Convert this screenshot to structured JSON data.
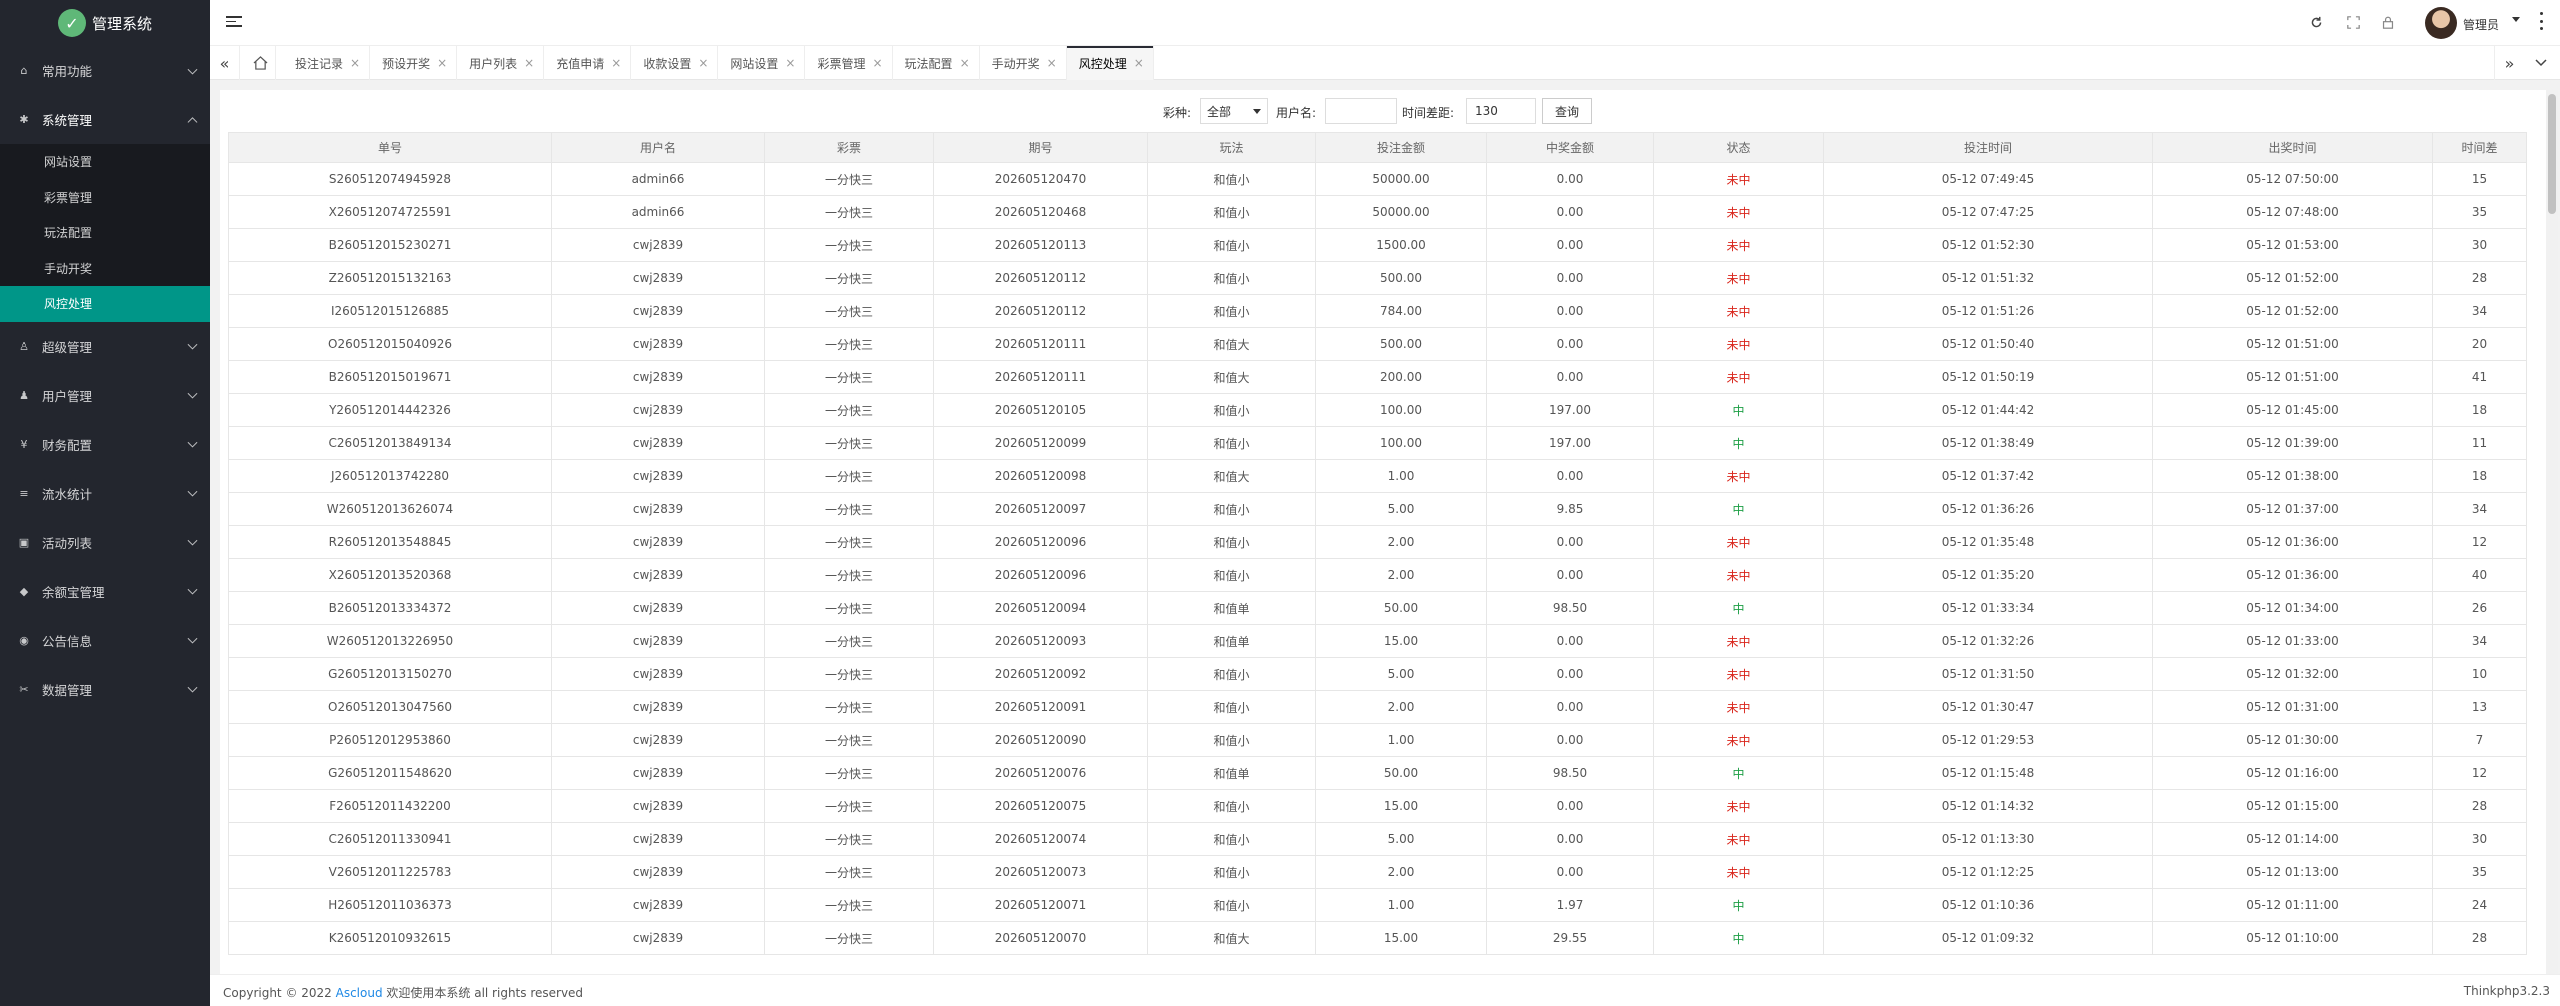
{
  "app": {
    "title": "管理系统",
    "logo_icon": "leaf-logo-icon"
  },
  "header": {
    "user": "管理员",
    "icons": [
      "refresh-icon",
      "fullscreen-icon",
      "lock-icon"
    ]
  },
  "sidebar": {
    "items": [
      {
        "label": "常用功能",
        "icon": "home-icon",
        "open": false
      },
      {
        "label": "系统管理",
        "icon": "gear-icon",
        "open": true,
        "children": [
          {
            "label": "网站设置",
            "active": false
          },
          {
            "label": "彩票管理",
            "active": false
          },
          {
            "label": "玩法配置",
            "active": false
          },
          {
            "label": "手动开奖",
            "active": false
          },
          {
            "label": "风控处理",
            "active": true
          }
        ]
      },
      {
        "label": "超级管理",
        "icon": "user-icon",
        "open": false
      },
      {
        "label": "用户管理",
        "icon": "users-icon",
        "open": false
      },
      {
        "label": "财务配置",
        "icon": "money-icon",
        "open": false
      },
      {
        "label": "流水统计",
        "icon": "list-icon",
        "open": false
      },
      {
        "label": "活动列表",
        "icon": "gift-icon",
        "open": false
      },
      {
        "label": "余额宝管理",
        "icon": "diamond-icon",
        "open": false
      },
      {
        "label": "公告信息",
        "icon": "bell-icon",
        "open": false
      },
      {
        "label": "数据管理",
        "icon": "database-icon",
        "open": false
      }
    ]
  },
  "tabs": [
    {
      "label": "投注记录",
      "active": false
    },
    {
      "label": "预设开奖",
      "active": false
    },
    {
      "label": "用户列表",
      "active": false
    },
    {
      "label": "充值申请",
      "active": false
    },
    {
      "label": "收款设置",
      "active": false
    },
    {
      "label": "网站设置",
      "active": false
    },
    {
      "label": "彩票管理",
      "active": false
    },
    {
      "label": "玩法配置",
      "active": false
    },
    {
      "label": "手动开奖",
      "active": false
    },
    {
      "label": "风控处理",
      "active": true
    }
  ],
  "filter": {
    "lottery_label": "彩种:",
    "lottery_value": "全部",
    "username_label": "用户名:",
    "username_value": "",
    "timediff_label": "时间差距:",
    "timediff_value": "130",
    "query_label": "查询"
  },
  "table": {
    "columns": [
      "单号",
      "用户名",
      "彩票",
      "期号",
      "玩法",
      "投注金额",
      "中奖金额",
      "状态",
      "投注时间",
      "出奖时间",
      "时间差"
    ],
    "rows": [
      [
        "S260512074945928",
        "admin66",
        "一分快三",
        "202605120470",
        "和值小",
        "50000.00",
        "0.00",
        "未中",
        "05-12 07:49:45",
        "05-12 07:50:00",
        "15"
      ],
      [
        "X260512074725591",
        "admin66",
        "一分快三",
        "202605120468",
        "和值小",
        "50000.00",
        "0.00",
        "未中",
        "05-12 07:47:25",
        "05-12 07:48:00",
        "35"
      ],
      [
        "B260512015230271",
        "cwj2839",
        "一分快三",
        "202605120113",
        "和值小",
        "1500.00",
        "0.00",
        "未中",
        "05-12 01:52:30",
        "05-12 01:53:00",
        "30"
      ],
      [
        "Z260512015132163",
        "cwj2839",
        "一分快三",
        "202605120112",
        "和值小",
        "500.00",
        "0.00",
        "未中",
        "05-12 01:51:32",
        "05-12 01:52:00",
        "28"
      ],
      [
        "I260512015126885",
        "cwj2839",
        "一分快三",
        "202605120112",
        "和值小",
        "784.00",
        "0.00",
        "未中",
        "05-12 01:51:26",
        "05-12 01:52:00",
        "34"
      ],
      [
        "O260512015040926",
        "cwj2839",
        "一分快三",
        "202605120111",
        "和值大",
        "500.00",
        "0.00",
        "未中",
        "05-12 01:50:40",
        "05-12 01:51:00",
        "20"
      ],
      [
        "B260512015019671",
        "cwj2839",
        "一分快三",
        "202605120111",
        "和值大",
        "200.00",
        "0.00",
        "未中",
        "05-12 01:50:19",
        "05-12 01:51:00",
        "41"
      ],
      [
        "Y260512014442326",
        "cwj2839",
        "一分快三",
        "202605120105",
        "和值小",
        "100.00",
        "197.00",
        "中",
        "05-12 01:44:42",
        "05-12 01:45:00",
        "18"
      ],
      [
        "C260512013849134",
        "cwj2839",
        "一分快三",
        "202605120099",
        "和值小",
        "100.00",
        "197.00",
        "中",
        "05-12 01:38:49",
        "05-12 01:39:00",
        "11"
      ],
      [
        "J260512013742280",
        "cwj2839",
        "一分快三",
        "202605120098",
        "和值大",
        "1.00",
        "0.00",
        "未中",
        "05-12 01:37:42",
        "05-12 01:38:00",
        "18"
      ],
      [
        "W260512013626074",
        "cwj2839",
        "一分快三",
        "202605120097",
        "和值小",
        "5.00",
        "9.85",
        "中",
        "05-12 01:36:26",
        "05-12 01:37:00",
        "34"
      ],
      [
        "R260512013548845",
        "cwj2839",
        "一分快三",
        "202605120096",
        "和值小",
        "2.00",
        "0.00",
        "未中",
        "05-12 01:35:48",
        "05-12 01:36:00",
        "12"
      ],
      [
        "X260512013520368",
        "cwj2839",
        "一分快三",
        "202605120096",
        "和值小",
        "2.00",
        "0.00",
        "未中",
        "05-12 01:35:20",
        "05-12 01:36:00",
        "40"
      ],
      [
        "B260512013334372",
        "cwj2839",
        "一分快三",
        "202605120094",
        "和值单",
        "50.00",
        "98.50",
        "中",
        "05-12 01:33:34",
        "05-12 01:34:00",
        "26"
      ],
      [
        "W260512013226950",
        "cwj2839",
        "一分快三",
        "202605120093",
        "和值单",
        "15.00",
        "0.00",
        "未中",
        "05-12 01:32:26",
        "05-12 01:33:00",
        "34"
      ],
      [
        "G260512013150270",
        "cwj2839",
        "一分快三",
        "202605120092",
        "和值小",
        "5.00",
        "0.00",
        "未中",
        "05-12 01:31:50",
        "05-12 01:32:00",
        "10"
      ],
      [
        "O260512013047560",
        "cwj2839",
        "一分快三",
        "202605120091",
        "和值小",
        "2.00",
        "0.00",
        "未中",
        "05-12 01:30:47",
        "05-12 01:31:00",
        "13"
      ],
      [
        "P260512012953860",
        "cwj2839",
        "一分快三",
        "202605120090",
        "和值小",
        "1.00",
        "0.00",
        "未中",
        "05-12 01:29:53",
        "05-12 01:30:00",
        "7"
      ],
      [
        "G260512011548620",
        "cwj2839",
        "一分快三",
        "202605120076",
        "和值单",
        "50.00",
        "98.50",
        "中",
        "05-12 01:15:48",
        "05-12 01:16:00",
        "12"
      ],
      [
        "F260512011432200",
        "cwj2839",
        "一分快三",
        "202605120075",
        "和值小",
        "15.00",
        "0.00",
        "未中",
        "05-12 01:14:32",
        "05-12 01:15:00",
        "28"
      ],
      [
        "C260512011330941",
        "cwj2839",
        "一分快三",
        "202605120074",
        "和值小",
        "5.00",
        "0.00",
        "未中",
        "05-12 01:13:30",
        "05-12 01:14:00",
        "30"
      ],
      [
        "V260512011225783",
        "cwj2839",
        "一分快三",
        "202605120073",
        "和值小",
        "2.00",
        "0.00",
        "未中",
        "05-12 01:12:25",
        "05-12 01:13:00",
        "35"
      ],
      [
        "H260512011036373",
        "cwj2839",
        "一分快三",
        "202605120071",
        "和值小",
        "1.00",
        "1.97",
        "中",
        "05-12 01:10:36",
        "05-12 01:11:00",
        "24"
      ],
      [
        "K260512010932615",
        "cwj2839",
        "一分快三",
        "202605120070",
        "和值大",
        "15.00",
        "29.55",
        "中",
        "05-12 01:09:32",
        "05-12 01:10:00",
        "28"
      ]
    ],
    "status_colors": {
      "未中": "#d9261c",
      "中": "#1e9f46"
    }
  },
  "footer": {
    "prefix": "Copyright © 2022 ",
    "brand": "Ascloud",
    "suffix": " 欢迎使用本系统 all rights reserved",
    "version": "Thinkphp3.2.3"
  }
}
